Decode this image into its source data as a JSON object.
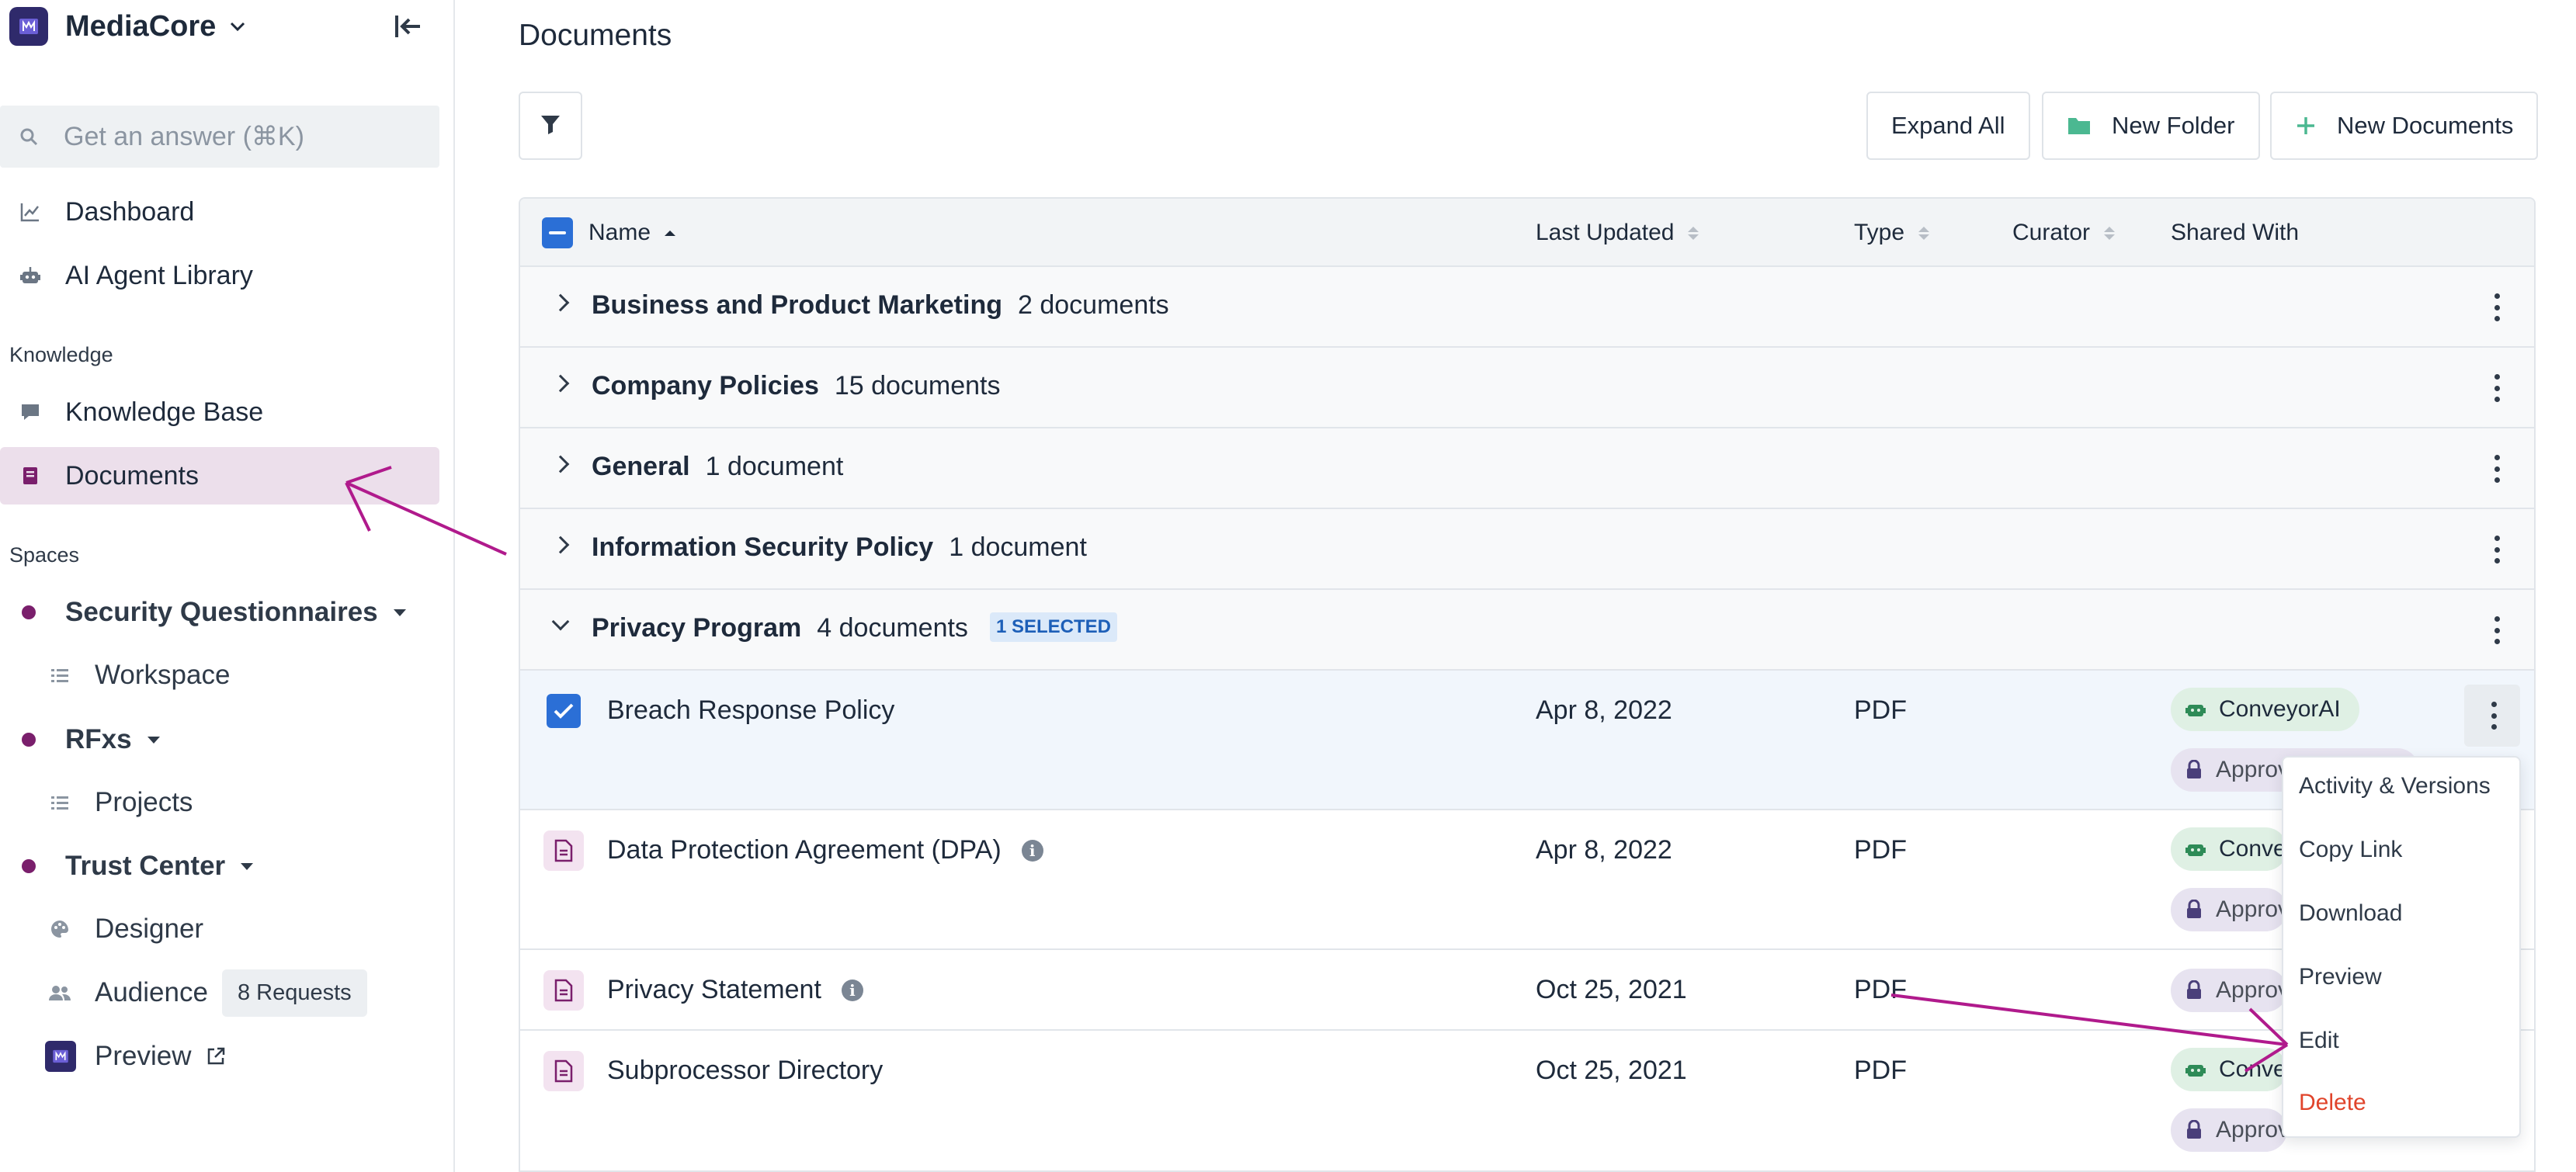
{
  "app": {
    "name": "MediaCore"
  },
  "sidebar": {
    "search_placeholder": "Get an answer (⌘K)",
    "top_items": [
      {
        "label": "Dashboard",
        "icon": "chart-line-icon"
      },
      {
        "label": "AI Agent Library",
        "icon": "robot-icon"
      }
    ],
    "knowledge_label": "Knowledge",
    "knowledge_items": [
      {
        "label": "Knowledge Base",
        "icon": "chat-bubble-icon"
      },
      {
        "label": "Documents",
        "icon": "book-icon",
        "active": true
      }
    ],
    "spaces_label": "Spaces",
    "spaces": [
      {
        "label": "Security Questionnaires",
        "children": [
          {
            "label": "Workspace",
            "icon": "list-icon"
          }
        ]
      },
      {
        "label": "RFxs",
        "children": [
          {
            "label": "Projects",
            "icon": "list-icon"
          }
        ]
      },
      {
        "label": "Trust Center",
        "children": [
          {
            "label": "Designer",
            "icon": "palette-icon"
          },
          {
            "label": "Audience",
            "icon": "users-icon",
            "badge": "8 Requests"
          },
          {
            "label": "Preview",
            "icon": "app-logo-icon"
          }
        ]
      }
    ]
  },
  "main": {
    "title": "Documents",
    "toolbar": {
      "expand_all": "Expand All",
      "new_folder": "New Folder",
      "new_documents": "New Documents"
    },
    "columns": {
      "name": "Name",
      "last_updated": "Last Updated",
      "type": "Type",
      "curator": "Curator",
      "shared_with": "Shared With"
    },
    "groups": [
      {
        "name": "Business and Product Marketing",
        "count": "2 documents"
      },
      {
        "name": "Company Policies",
        "count": "15 documents"
      },
      {
        "name": "General",
        "count": "1 document"
      },
      {
        "name": "Information Security Policy",
        "count": "1 document"
      },
      {
        "name": "Privacy Program",
        "count": "4 documents",
        "selected_badge": "1 SELECTED",
        "expanded": true
      }
    ],
    "documents": [
      {
        "name": "Breach Response Policy",
        "updated": "Apr 8, 2022",
        "type": "PDF",
        "tags": [
          "ConveyorAI",
          "Approved"
        ],
        "selected": true
      },
      {
        "name": "Data Protection Agreement (DPA)",
        "updated": "Apr 8, 2022",
        "type": "PDF",
        "tags": [
          "ConveyorAI",
          "Approved"
        ],
        "info": true
      },
      {
        "name": "Privacy Statement",
        "updated": "Oct 25, 2021",
        "type": "PDF",
        "tags": [
          "Approved"
        ],
        "info": true
      },
      {
        "name": "Subprocessor Directory",
        "updated": "Oct 25, 2021",
        "type": "PDF",
        "tags": [
          "ConveyorAI",
          "Approved"
        ]
      }
    ],
    "context_menu": [
      "Activity & Versions",
      "Copy Link",
      "Download",
      "Preview",
      "Edit",
      "Delete"
    ]
  },
  "colors": {
    "accent": "#7a1f6c",
    "active_nav_bg": "#ecdfeb",
    "primary_blue": "#2b6fd6",
    "ai_tag_bg": "#dff0e4",
    "approved_tag_bg": "#e7e3f0",
    "danger": "#e0442b",
    "annotation_arrow": "#b01a8c"
  }
}
